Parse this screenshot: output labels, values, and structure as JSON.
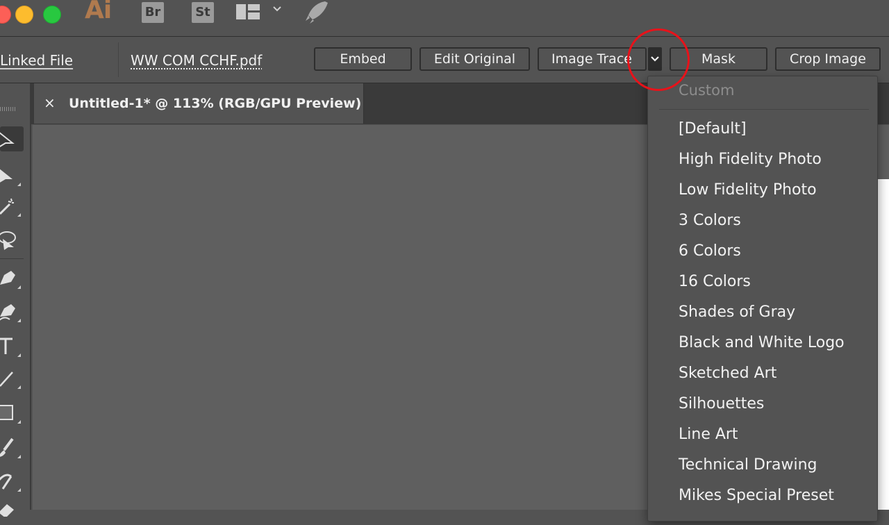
{
  "titlebar": {
    "app_logo": "Ai",
    "bridge_label": "Br",
    "stock_label": "St",
    "icons": [
      "workspace-switcher-icon",
      "chevron-down-icon",
      "rocket-icon"
    ]
  },
  "controlbar": {
    "linked_file_label": "Linked File",
    "file_name": "WW COM CCHF.pdf",
    "embed_label": "Embed",
    "edit_original_label": "Edit Original",
    "image_trace_label": "Image Trace",
    "mask_label": "Mask",
    "crop_image_label": "Crop Image"
  },
  "document": {
    "tab_title": "Untitled-1* @ 113% (RGB/GPU Preview)",
    "close_glyph": "×"
  },
  "image_trace_menu": {
    "header": "Custom",
    "items": [
      "[Default]",
      "High Fidelity Photo",
      "Low Fidelity Photo",
      "3 Colors",
      "6 Colors",
      "16 Colors",
      "Shades of Gray",
      "Black and White Logo",
      "Sketched Art",
      "Silhouettes",
      "Line Art",
      "Technical Drawing",
      "Mikes Special Preset"
    ]
  },
  "toolbar": {
    "tools": [
      "selection-tool-icon",
      "direct-selection-tool-icon",
      "magic-wand-icon",
      "lasso-icon",
      "pen-tool-icon",
      "curvature-tool-icon",
      "type-tool-icon",
      "line-tool-icon",
      "rectangle-tool-icon",
      "paintbrush-icon",
      "shaper-icon"
    ]
  },
  "colors": {
    "annotation_circle": "#e8121a",
    "ai_logo": "#b07a4e"
  }
}
